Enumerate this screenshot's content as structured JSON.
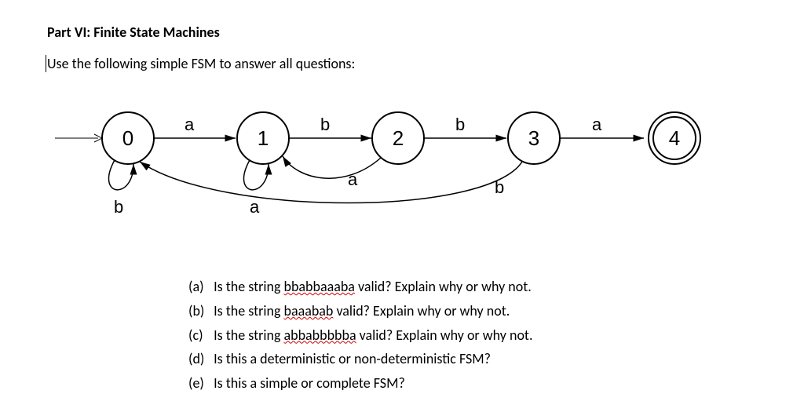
{
  "heading": "Part VI: Finite State Machines",
  "instruction": "Use the following simple FSM to answer all questions:",
  "fsm": {
    "states": [
      "0",
      "1",
      "2",
      "3",
      "4"
    ],
    "start_state": "0",
    "accept_states": [
      "4"
    ],
    "transitions": {
      "0_to_1": "a",
      "1_to_2": "b",
      "2_to_3": "b",
      "3_to_4": "a",
      "0_self": "b",
      "1_self": "a",
      "2_to_1": "a",
      "3_to_0": "b"
    }
  },
  "questions": [
    {
      "label": "(a)",
      "pre": "Is the string ",
      "squiggle": "bbabbaaaba",
      "post": " valid?  Explain why or why not."
    },
    {
      "label": "(b)",
      "pre": "Is the string ",
      "squiggle": "baaabab",
      "post": " valid?  Explain why or why not."
    },
    {
      "label": "(c)",
      "pre": "Is the string ",
      "squiggle": "abbabbbbba",
      "post": " valid?  Explain why or why not."
    },
    {
      "label": "(d)",
      "pre": "Is this a deterministic or non-deterministic FSM?",
      "squiggle": "",
      "post": ""
    },
    {
      "label": "(e)",
      "pre": "Is this a simple or complete FSM?",
      "squiggle": "",
      "post": ""
    }
  ]
}
